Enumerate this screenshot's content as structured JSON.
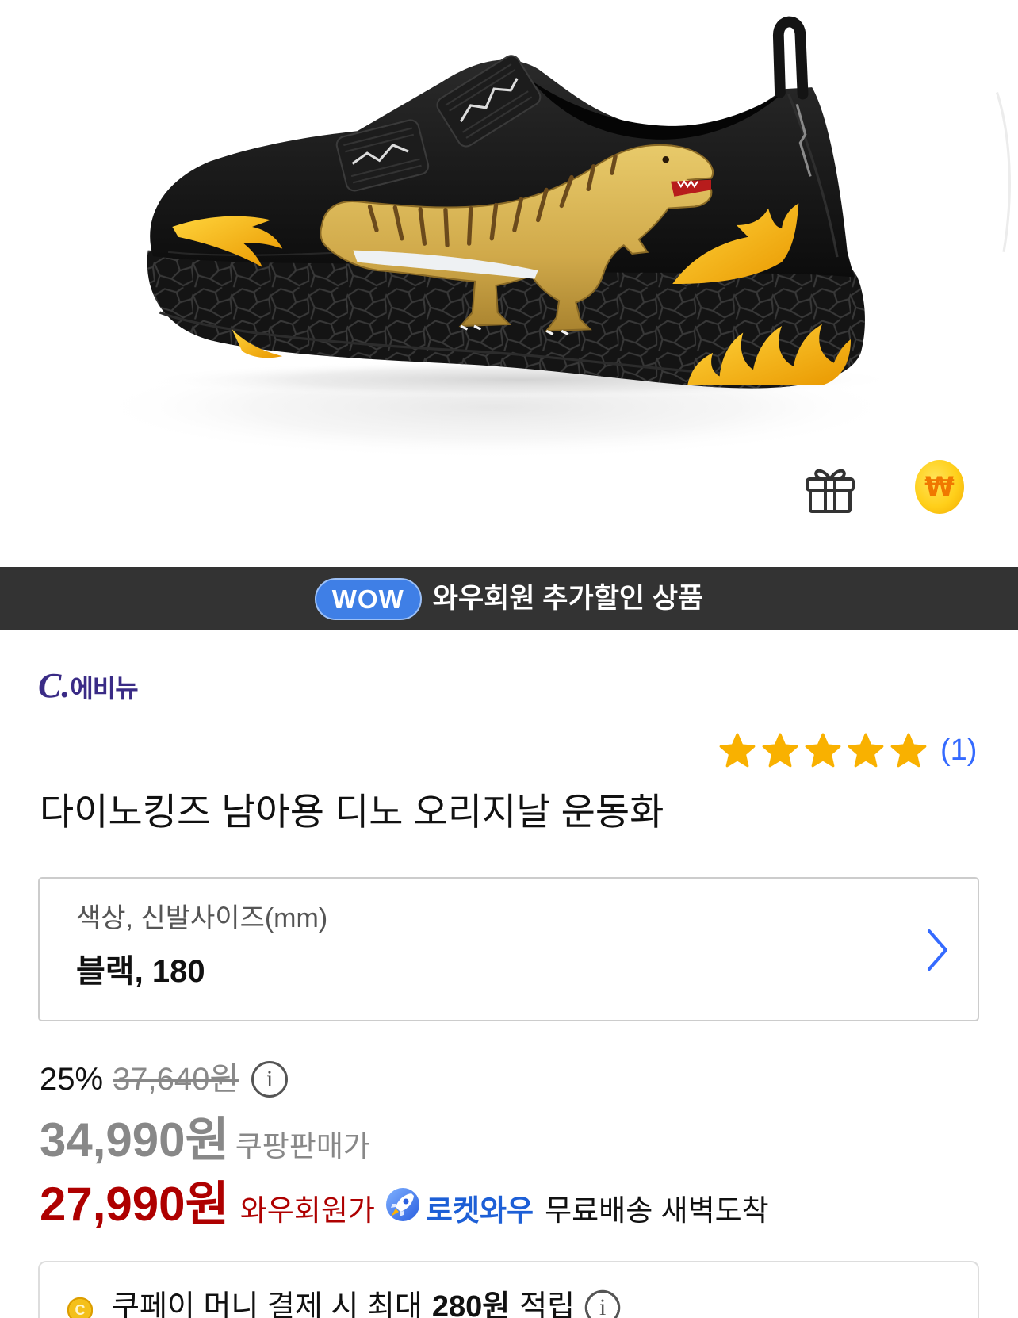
{
  "icons": {
    "gift": "gift-icon",
    "coin": "won-coin-icon",
    "info": "info-icon",
    "rocket": "rocket-icon",
    "chevron": "chevron-right-icon",
    "star": "star-icon",
    "coupay_coin": "coupay-coin-icon"
  },
  "reward": {
    "coin_symbol": "₩"
  },
  "wow_banner": {
    "badge": "WOW",
    "text": "와우회원 추가할인 상품"
  },
  "brand": {
    "logo_mark": "C.",
    "logo_name": "에비뉴"
  },
  "rating": {
    "value": 5,
    "max": 5,
    "count": "(1)"
  },
  "product": {
    "title": "다이노킹즈 남아용 디노 오리지날 운동화"
  },
  "option": {
    "label": "색상, 신발사이즈(mm)",
    "value": "블랙, 180"
  },
  "price": {
    "discount_rate": "25%",
    "original_price": "37,640원",
    "coupang_price": "34,990원",
    "coupang_price_label": "쿠팡판매가",
    "wow_price": "27,990원",
    "wow_price_label": "와우회원가",
    "rocket_badge": "로켓와우",
    "delivery": "무료배송 새벽도착"
  },
  "coupay": {
    "coin_letter": "C",
    "text_prefix": "쿠페이 머니 결제 시 최대",
    "amount": "280원",
    "text_suffix": "적립"
  },
  "colors": {
    "wow_banner_bg": "#333333",
    "wow_badge": "#3f7fe6",
    "brand": "#3a2b86",
    "star": "#f9b100",
    "star_empty": "#dddddd",
    "rating_count": "#346aff",
    "wow_price": "#ae0000",
    "rocket": "#1d5fd6",
    "muted": "#888888",
    "chevron": "#346aff",
    "shoe_accent": "#f2b50f"
  }
}
